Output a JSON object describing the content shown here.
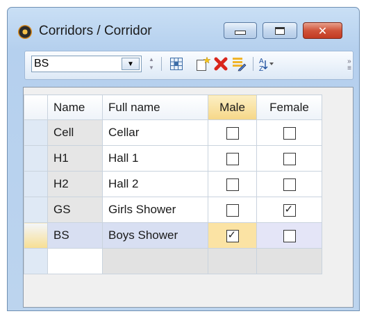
{
  "window": {
    "title": "Corridors / Corridor"
  },
  "window_buttons": {
    "close_glyph": "✕"
  },
  "toolbar": {
    "combo_value": "BS",
    "icons": [
      "table-icon",
      "new-record-icon",
      "delete-icon",
      "edit-list-icon",
      "sort-icon"
    ]
  },
  "grid": {
    "columns": [
      "Name",
      "Full name",
      "Male",
      "Female"
    ],
    "rows": [
      {
        "name": "Cell",
        "full_name": "Cellar",
        "male": false,
        "female": false
      },
      {
        "name": "H1",
        "full_name": "Hall 1",
        "male": false,
        "female": false
      },
      {
        "name": "H2",
        "full_name": "Hall 2",
        "male": false,
        "female": false
      },
      {
        "name": "GS",
        "full_name": "Girls Shower",
        "male": false,
        "female": true
      },
      {
        "name": "BS",
        "full_name": "Boys Shower",
        "male": true,
        "female": false
      }
    ],
    "current_row_name": "BS",
    "check_glyph": "✓",
    "colors": {
      "current_row": "#d8dff2",
      "header_highlight": "#f6d788"
    }
  }
}
